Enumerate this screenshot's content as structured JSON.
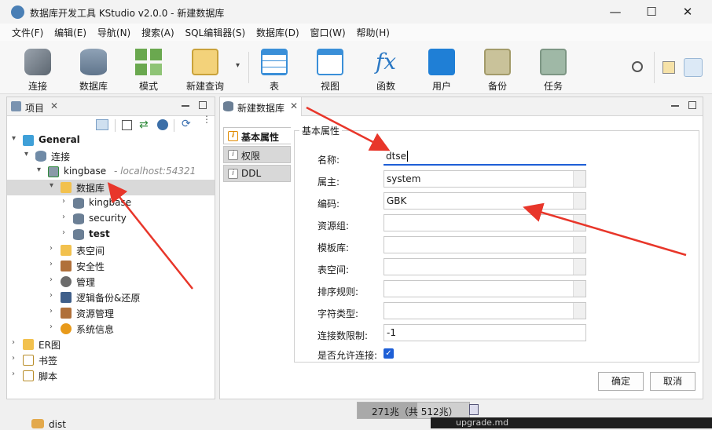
{
  "window": {
    "title": "数据库开发工具 KStudio v2.0.0 - 新建数据库",
    "min_label": "—",
    "max_label": "☐",
    "close_label": "✕"
  },
  "menu": [
    "文件(F)",
    "编辑(E)",
    "导航(N)",
    "搜索(A)",
    "SQL编辑器(S)",
    "数据库(D)",
    "窗口(W)",
    "帮助(H)"
  ],
  "toolbar": {
    "buttons": [
      {
        "label": "连接",
        "icon": "plug-icon"
      },
      {
        "label": "数据库",
        "icon": "database-icon"
      },
      {
        "label": "模式",
        "icon": "schema-icon"
      },
      {
        "label": "新建查询",
        "icon": "new-query-icon"
      },
      {
        "label": "表",
        "icon": "table-icon"
      },
      {
        "label": "视图",
        "icon": "view-icon"
      },
      {
        "label": "函数",
        "icon": "function-icon"
      },
      {
        "label": "用户",
        "icon": "user-icon"
      },
      {
        "label": "备份",
        "icon": "backup-icon"
      },
      {
        "label": "任务",
        "icon": "task-icon"
      }
    ],
    "function_glyph": "fx",
    "dropdown_glyph": "▾"
  },
  "project_panel": {
    "tab_label": "项目",
    "tree": {
      "general": "General",
      "connection": "连接",
      "server": "kingbase",
      "server_host": "- localhost:54321",
      "databases_folder": "数据库",
      "databases": [
        "kingbase",
        "security",
        "test"
      ],
      "children": [
        "表空间",
        "安全性",
        "管理",
        "逻辑备份&还原",
        "资源管理",
        "系统信息"
      ],
      "roots": [
        "ER图",
        "书签",
        "脚本"
      ]
    }
  },
  "editor": {
    "tab_label": "新建数据库",
    "side_tabs": [
      "基本属性",
      "权限",
      "DDL"
    ],
    "section_title": "基本属性",
    "fields": [
      {
        "label": "名称:",
        "value": "dtse"
      },
      {
        "label": "属主:",
        "value": "system"
      },
      {
        "label": "编码:",
        "value": "GBK"
      },
      {
        "label": "资源组:",
        "value": ""
      },
      {
        "label": "模板库:",
        "value": ""
      },
      {
        "label": "表空间:",
        "value": ""
      },
      {
        "label": "排序规则:",
        "value": ""
      },
      {
        "label": "字符类型:",
        "value": ""
      },
      {
        "label": "连接数限制:",
        "value": "-1"
      }
    ],
    "allow_connect_label": "是否允许连接:",
    "allow_connect_checked": true,
    "ok_label": "确定",
    "cancel_label": "取消"
  },
  "status": {
    "memory": "271兆（共 512兆）"
  },
  "background_taskbar": {
    "folder_label": "dist",
    "file_label": "upgrade.md"
  },
  "colors": {
    "accent": "#1e5fd6",
    "annotation_arrow": "#e8362a",
    "selection": "#d9d9d9"
  }
}
